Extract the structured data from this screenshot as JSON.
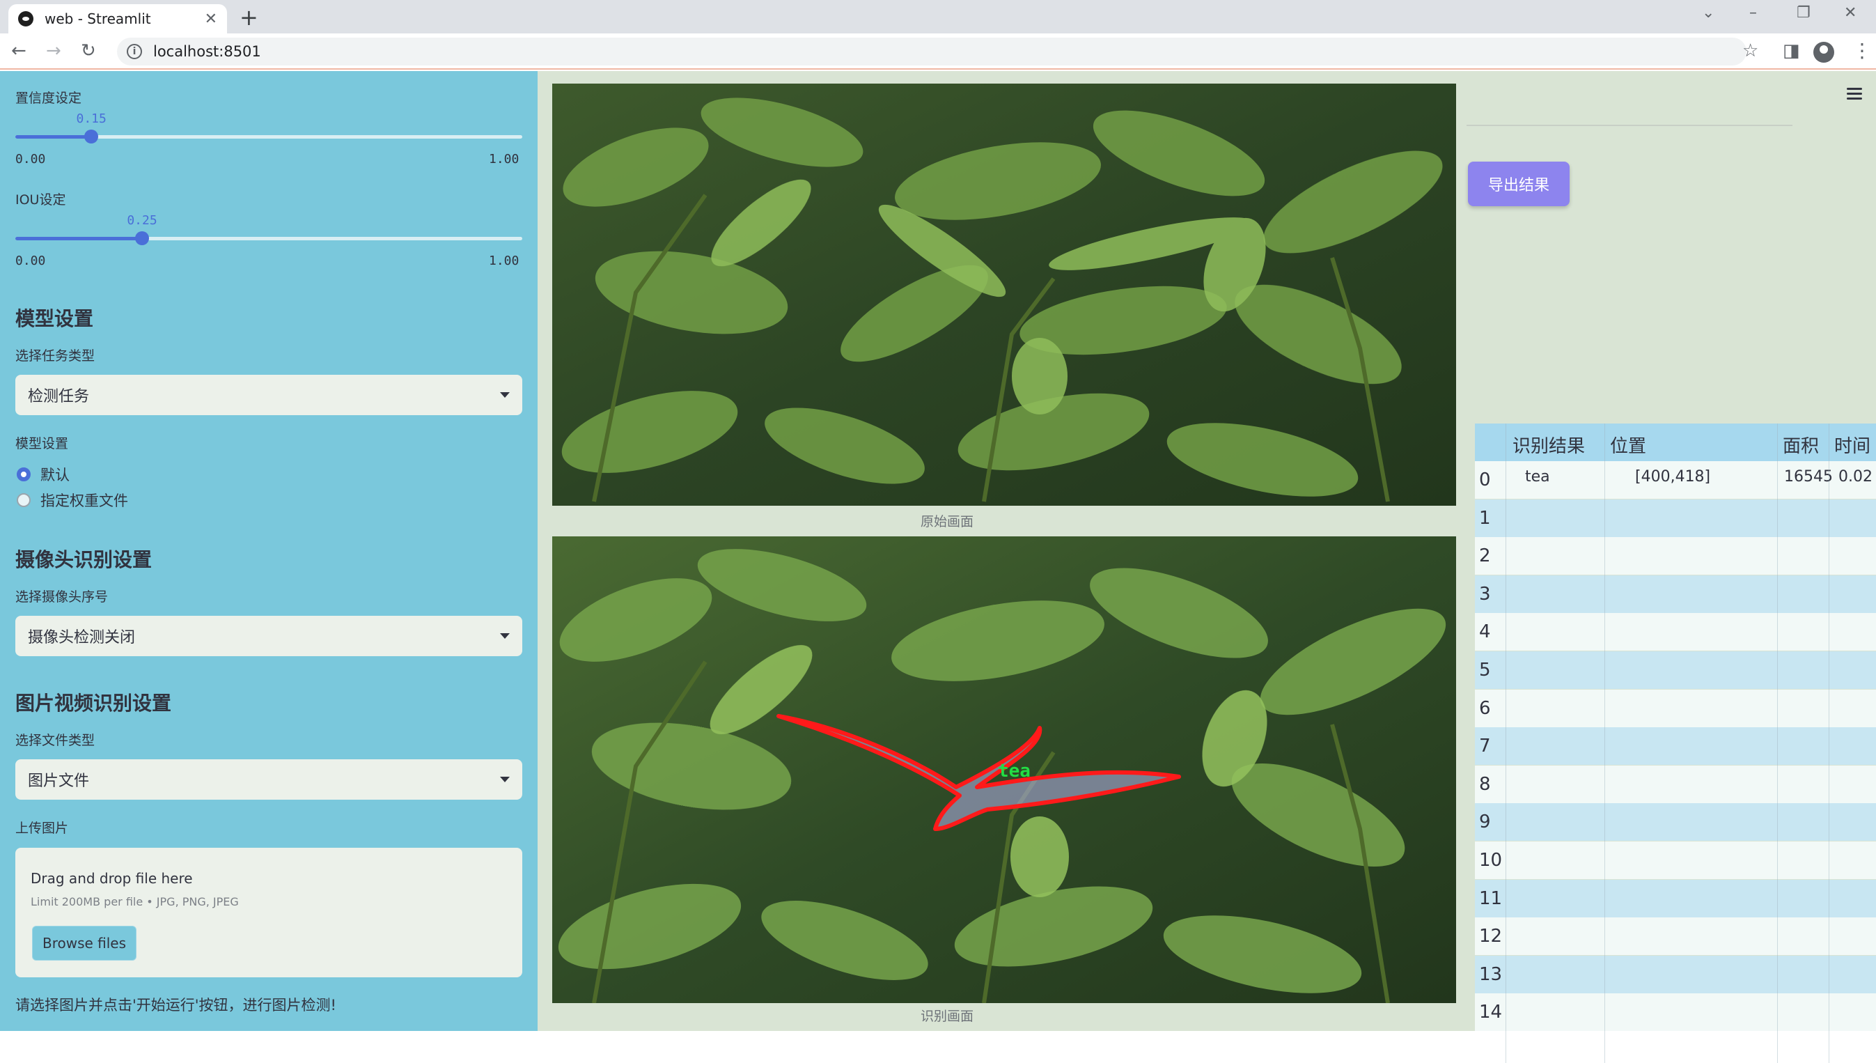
{
  "browser": {
    "tab_title": "web - Streamlit",
    "url": "localhost:8501"
  },
  "sidebar": {
    "confidence": {
      "label": "置信度设定",
      "value": "0.15",
      "min": "0.00",
      "max": "1.00",
      "fraction": 0.15
    },
    "iou": {
      "label": "IOU设定",
      "value": "0.25",
      "min": "0.00",
      "max": "1.00",
      "fraction": 0.25
    },
    "model_heading": "模型设置",
    "task_label": "选择任务类型",
    "task_value": "检测任务",
    "model_label": "模型设置",
    "model_options": [
      "默认",
      "指定权重文件"
    ],
    "model_selected": 0,
    "camera_heading": "摄像头识别设置",
    "camera_label": "选择摄像头序号",
    "camera_value": "摄像头检测关闭",
    "media_heading": "图片视频识别设置",
    "filetype_label": "选择文件类型",
    "filetype_value": "图片文件",
    "upload_label": "上传图片",
    "upload_title": "Drag and drop file here",
    "upload_limit": "Limit 200MB per file • JPG, PNG, JPEG",
    "browse_label": "Browse files",
    "footer_text": "请选择图片并点击'开始运行'按钮，进行图片检测!"
  },
  "main": {
    "original_caption": "原始画面",
    "detected_caption": "识别画面",
    "detection_label": "tea"
  },
  "right": {
    "export_label": "导出结果",
    "table": {
      "headers": [
        "识别结果",
        "位置",
        "面积",
        "时间"
      ],
      "rows": [
        {
          "idx": "0",
          "result": "tea",
          "position": "[400,418]",
          "area": "16545",
          "time": "0.02"
        },
        {
          "idx": "1"
        },
        {
          "idx": "2"
        },
        {
          "idx": "3"
        },
        {
          "idx": "4"
        },
        {
          "idx": "5"
        },
        {
          "idx": "6"
        },
        {
          "idx": "7"
        },
        {
          "idx": "8"
        },
        {
          "idx": "9"
        },
        {
          "idx": "10"
        },
        {
          "idx": "11"
        },
        {
          "idx": "12"
        },
        {
          "idx": "13"
        },
        {
          "idx": "14"
        }
      ]
    }
  },
  "colors": {
    "sidebar_bg": "#7ac8dc",
    "accent": "#4a6fd8",
    "export_button": "#8d84ee",
    "detection_outline": "#ff1a1a",
    "detection_label": "#22dd44"
  }
}
